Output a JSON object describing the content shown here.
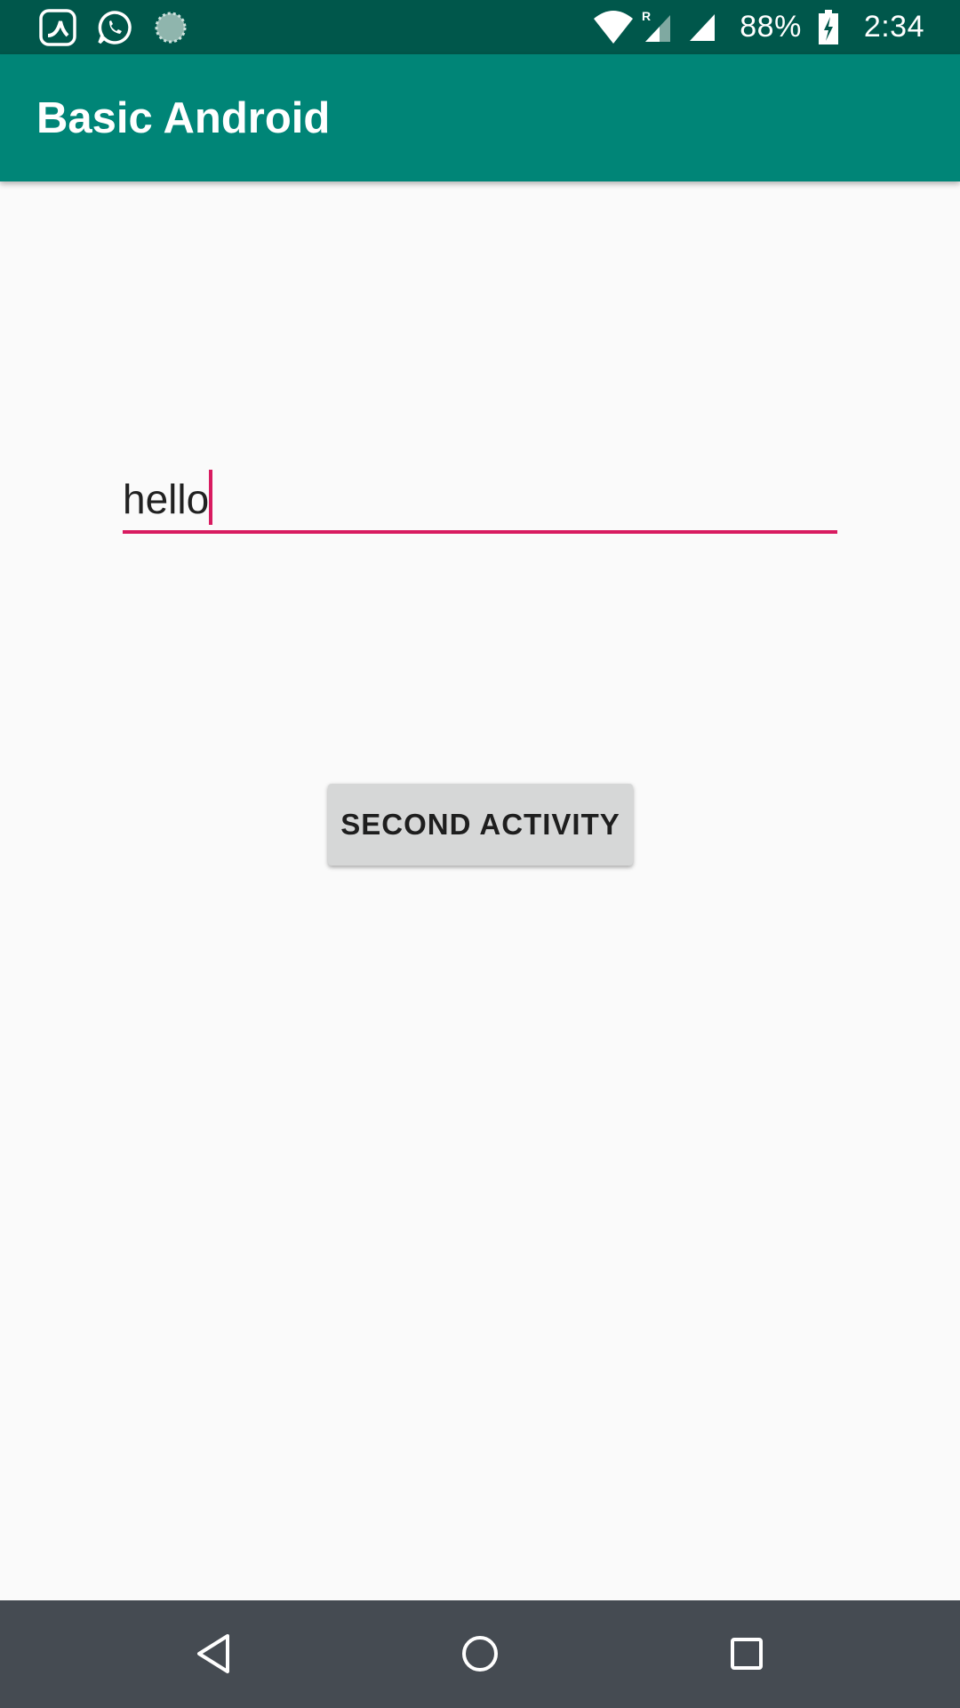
{
  "status_bar": {
    "left_icons": [
      "saavn-icon",
      "whatsapp-icon",
      "sync-icon"
    ],
    "battery_percent": "88%",
    "time": "2:34",
    "background_color": "#00574b"
  },
  "app_bar": {
    "title": "Basic Android",
    "background_color": "#008577"
  },
  "main": {
    "edit_text": {
      "value": "hello",
      "underline_color": "#d81b60"
    },
    "button_label": "SECOND ACTIVITY"
  },
  "nav_bar": {
    "buttons": [
      "back-icon",
      "home-icon",
      "recents-icon"
    ]
  }
}
